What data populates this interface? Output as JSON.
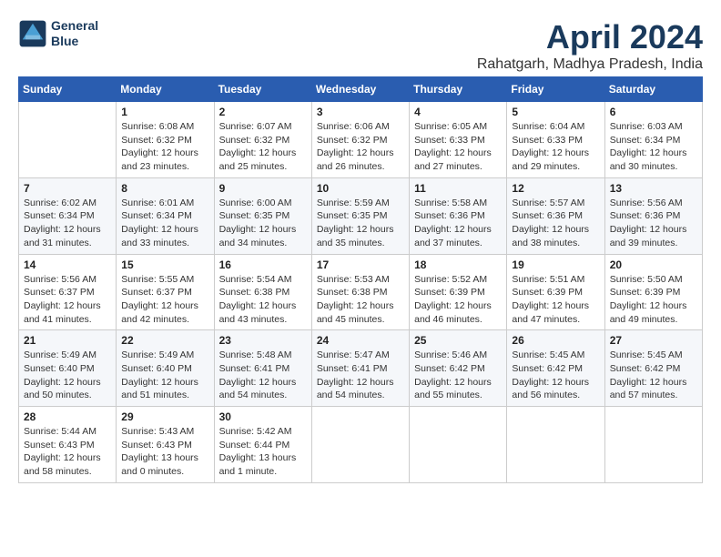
{
  "logo": {
    "line1": "General",
    "line2": "Blue"
  },
  "title": "April 2024",
  "location": "Rahatgarh, Madhya Pradesh, India",
  "weekdays": [
    "Sunday",
    "Monday",
    "Tuesday",
    "Wednesday",
    "Thursday",
    "Friday",
    "Saturday"
  ],
  "weeks": [
    [
      {
        "day": "",
        "sunrise": "",
        "sunset": "",
        "daylight": ""
      },
      {
        "day": "1",
        "sunrise": "Sunrise: 6:08 AM",
        "sunset": "Sunset: 6:32 PM",
        "daylight": "Daylight: 12 hours and 23 minutes."
      },
      {
        "day": "2",
        "sunrise": "Sunrise: 6:07 AM",
        "sunset": "Sunset: 6:32 PM",
        "daylight": "Daylight: 12 hours and 25 minutes."
      },
      {
        "day": "3",
        "sunrise": "Sunrise: 6:06 AM",
        "sunset": "Sunset: 6:32 PM",
        "daylight": "Daylight: 12 hours and 26 minutes."
      },
      {
        "day": "4",
        "sunrise": "Sunrise: 6:05 AM",
        "sunset": "Sunset: 6:33 PM",
        "daylight": "Daylight: 12 hours and 27 minutes."
      },
      {
        "day": "5",
        "sunrise": "Sunrise: 6:04 AM",
        "sunset": "Sunset: 6:33 PM",
        "daylight": "Daylight: 12 hours and 29 minutes."
      },
      {
        "day": "6",
        "sunrise": "Sunrise: 6:03 AM",
        "sunset": "Sunset: 6:34 PM",
        "daylight": "Daylight: 12 hours and 30 minutes."
      }
    ],
    [
      {
        "day": "7",
        "sunrise": "Sunrise: 6:02 AM",
        "sunset": "Sunset: 6:34 PM",
        "daylight": "Daylight: 12 hours and 31 minutes."
      },
      {
        "day": "8",
        "sunrise": "Sunrise: 6:01 AM",
        "sunset": "Sunset: 6:34 PM",
        "daylight": "Daylight: 12 hours and 33 minutes."
      },
      {
        "day": "9",
        "sunrise": "Sunrise: 6:00 AM",
        "sunset": "Sunset: 6:35 PM",
        "daylight": "Daylight: 12 hours and 34 minutes."
      },
      {
        "day": "10",
        "sunrise": "Sunrise: 5:59 AM",
        "sunset": "Sunset: 6:35 PM",
        "daylight": "Daylight: 12 hours and 35 minutes."
      },
      {
        "day": "11",
        "sunrise": "Sunrise: 5:58 AM",
        "sunset": "Sunset: 6:36 PM",
        "daylight": "Daylight: 12 hours and 37 minutes."
      },
      {
        "day": "12",
        "sunrise": "Sunrise: 5:57 AM",
        "sunset": "Sunset: 6:36 PM",
        "daylight": "Daylight: 12 hours and 38 minutes."
      },
      {
        "day": "13",
        "sunrise": "Sunrise: 5:56 AM",
        "sunset": "Sunset: 6:36 PM",
        "daylight": "Daylight: 12 hours and 39 minutes."
      }
    ],
    [
      {
        "day": "14",
        "sunrise": "Sunrise: 5:56 AM",
        "sunset": "Sunset: 6:37 PM",
        "daylight": "Daylight: 12 hours and 41 minutes."
      },
      {
        "day": "15",
        "sunrise": "Sunrise: 5:55 AM",
        "sunset": "Sunset: 6:37 PM",
        "daylight": "Daylight: 12 hours and 42 minutes."
      },
      {
        "day": "16",
        "sunrise": "Sunrise: 5:54 AM",
        "sunset": "Sunset: 6:38 PM",
        "daylight": "Daylight: 12 hours and 43 minutes."
      },
      {
        "day": "17",
        "sunrise": "Sunrise: 5:53 AM",
        "sunset": "Sunset: 6:38 PM",
        "daylight": "Daylight: 12 hours and 45 minutes."
      },
      {
        "day": "18",
        "sunrise": "Sunrise: 5:52 AM",
        "sunset": "Sunset: 6:39 PM",
        "daylight": "Daylight: 12 hours and 46 minutes."
      },
      {
        "day": "19",
        "sunrise": "Sunrise: 5:51 AM",
        "sunset": "Sunset: 6:39 PM",
        "daylight": "Daylight: 12 hours and 47 minutes."
      },
      {
        "day": "20",
        "sunrise": "Sunrise: 5:50 AM",
        "sunset": "Sunset: 6:39 PM",
        "daylight": "Daylight: 12 hours and 49 minutes."
      }
    ],
    [
      {
        "day": "21",
        "sunrise": "Sunrise: 5:49 AM",
        "sunset": "Sunset: 6:40 PM",
        "daylight": "Daylight: 12 hours and 50 minutes."
      },
      {
        "day": "22",
        "sunrise": "Sunrise: 5:49 AM",
        "sunset": "Sunset: 6:40 PM",
        "daylight": "Daylight: 12 hours and 51 minutes."
      },
      {
        "day": "23",
        "sunrise": "Sunrise: 5:48 AM",
        "sunset": "Sunset: 6:41 PM",
        "daylight": "Daylight: 12 hours and 54 minutes."
      },
      {
        "day": "24",
        "sunrise": "Sunrise: 5:47 AM",
        "sunset": "Sunset: 6:41 PM",
        "daylight": "Daylight: 12 hours and 54 minutes."
      },
      {
        "day": "25",
        "sunrise": "Sunrise: 5:46 AM",
        "sunset": "Sunset: 6:42 PM",
        "daylight": "Daylight: 12 hours and 55 minutes."
      },
      {
        "day": "26",
        "sunrise": "Sunrise: 5:45 AM",
        "sunset": "Sunset: 6:42 PM",
        "daylight": "Daylight: 12 hours and 56 minutes."
      },
      {
        "day": "27",
        "sunrise": "Sunrise: 5:45 AM",
        "sunset": "Sunset: 6:42 PM",
        "daylight": "Daylight: 12 hours and 57 minutes."
      }
    ],
    [
      {
        "day": "28",
        "sunrise": "Sunrise: 5:44 AM",
        "sunset": "Sunset: 6:43 PM",
        "daylight": "Daylight: 12 hours and 58 minutes."
      },
      {
        "day": "29",
        "sunrise": "Sunrise: 5:43 AM",
        "sunset": "Sunset: 6:43 PM",
        "daylight": "Daylight: 13 hours and 0 minutes."
      },
      {
        "day": "30",
        "sunrise": "Sunrise: 5:42 AM",
        "sunset": "Sunset: 6:44 PM",
        "daylight": "Daylight: 13 hours and 1 minute."
      },
      {
        "day": "",
        "sunrise": "",
        "sunset": "",
        "daylight": ""
      },
      {
        "day": "",
        "sunrise": "",
        "sunset": "",
        "daylight": ""
      },
      {
        "day": "",
        "sunrise": "",
        "sunset": "",
        "daylight": ""
      },
      {
        "day": "",
        "sunrise": "",
        "sunset": "",
        "daylight": ""
      }
    ]
  ]
}
